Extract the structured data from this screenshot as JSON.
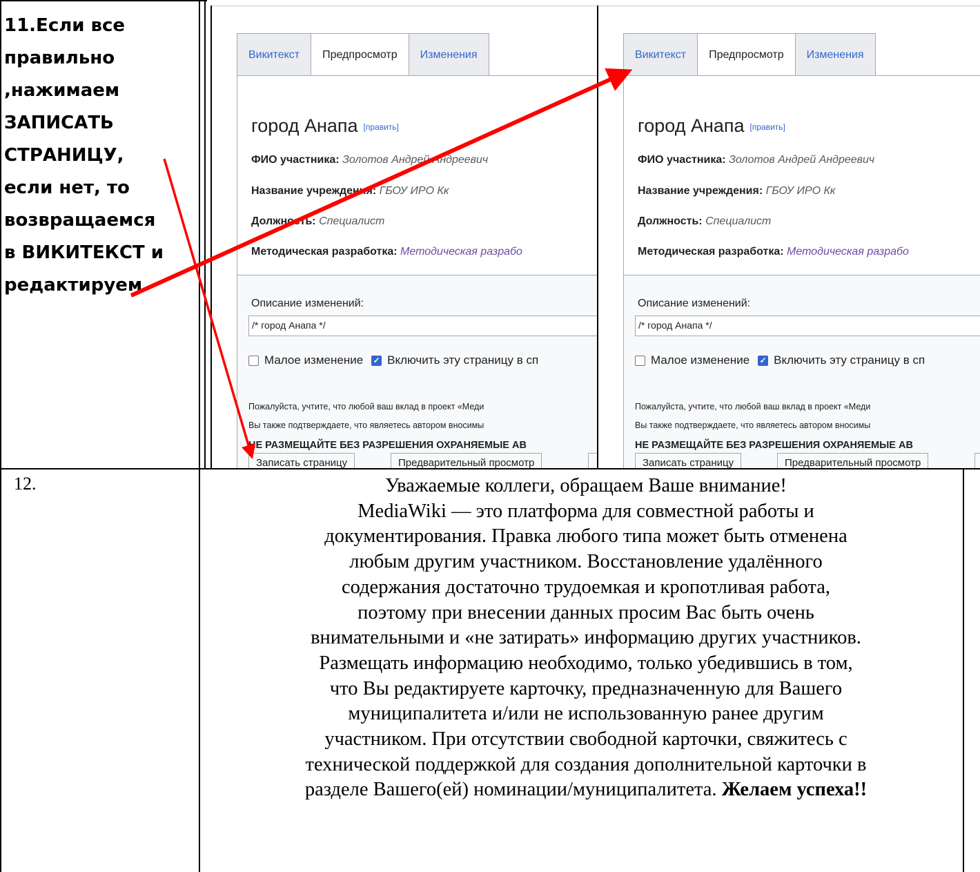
{
  "step11": {
    "lines": [
      "11.Если все",
      "правильно",
      ",нажимаем",
      "ЗАПИСАТЬ",
      "СТРАНИЦУ,",
      "если нет, то",
      "возвращаемся",
      "в ВИКИТЕКСТ и",
      "редактируем"
    ]
  },
  "screenshot": {
    "tabs": [
      "Викитекст",
      "Предпросмотр",
      "Изменения"
    ],
    "active_tab": "Предпросмотр",
    "page_title": "город Анапа",
    "edit_link": "[править]",
    "fields": [
      {
        "label": "ФИО участника:",
        "value": "Золотов Андрей Андреевич"
      },
      {
        "label": "Название учреждения:",
        "value": "ГБОУ ИРО Кк"
      },
      {
        "label": "Должность:",
        "value": "Специалист"
      },
      {
        "label": "Методическая разработка:",
        "value": "Методическая разрабо"
      }
    ],
    "summary_label": "Описание изменений:",
    "summary_value": "/* город Анапа */",
    "minor_edit_label": "Малое изменение",
    "watch_label": "Включить эту страницу в сп",
    "notice_line1": "Пожалуйста, учтите, что любой ваш вклад в проект «Меди",
    "notice_line2": "Вы также подтверждаете, что являетесь автором вносимы",
    "warning": "НЕ РАЗМЕЩАЙТЕ БЕЗ РАЗРЕШЕНИЯ ОХРАНЯЕМЫЕ АВ",
    "save_button": "Записать страницу",
    "preview_button": "Предварительный просмотр"
  },
  "step12": {
    "number": "12.",
    "lines": [
      "Уважаемые коллеги, обращаем Ваше внимание!",
      "MediaWiki — это платформа для совместной работы и",
      "документирования. Правка любого типа может быть отменена",
      "любым другим участником. Восстановление удалённого",
      "содержания достаточно трудоемкая и кропотливая работа,",
      "поэтому при внесении данных просим Вас быть очень",
      "внимательными и «не затирать» информацию других участников.",
      "Размещать информацию необходимо, только убедившись в том,",
      "что Вы редактируете карточку, предназначенную для  Вашего",
      "муниципалитета и/или не использованную ранее другим",
      "участником. При отсутствии свободной карточки, свяжитесь с",
      "технической поддержкой для создания дополнительной карточки в"
    ],
    "last_line": "разделе Вашего(ей) номинации/муниципалитета.",
    "closing": "Желаем успеха!!"
  },
  "colors": {
    "arrow": "#ff0000",
    "link": "#3366cc"
  }
}
